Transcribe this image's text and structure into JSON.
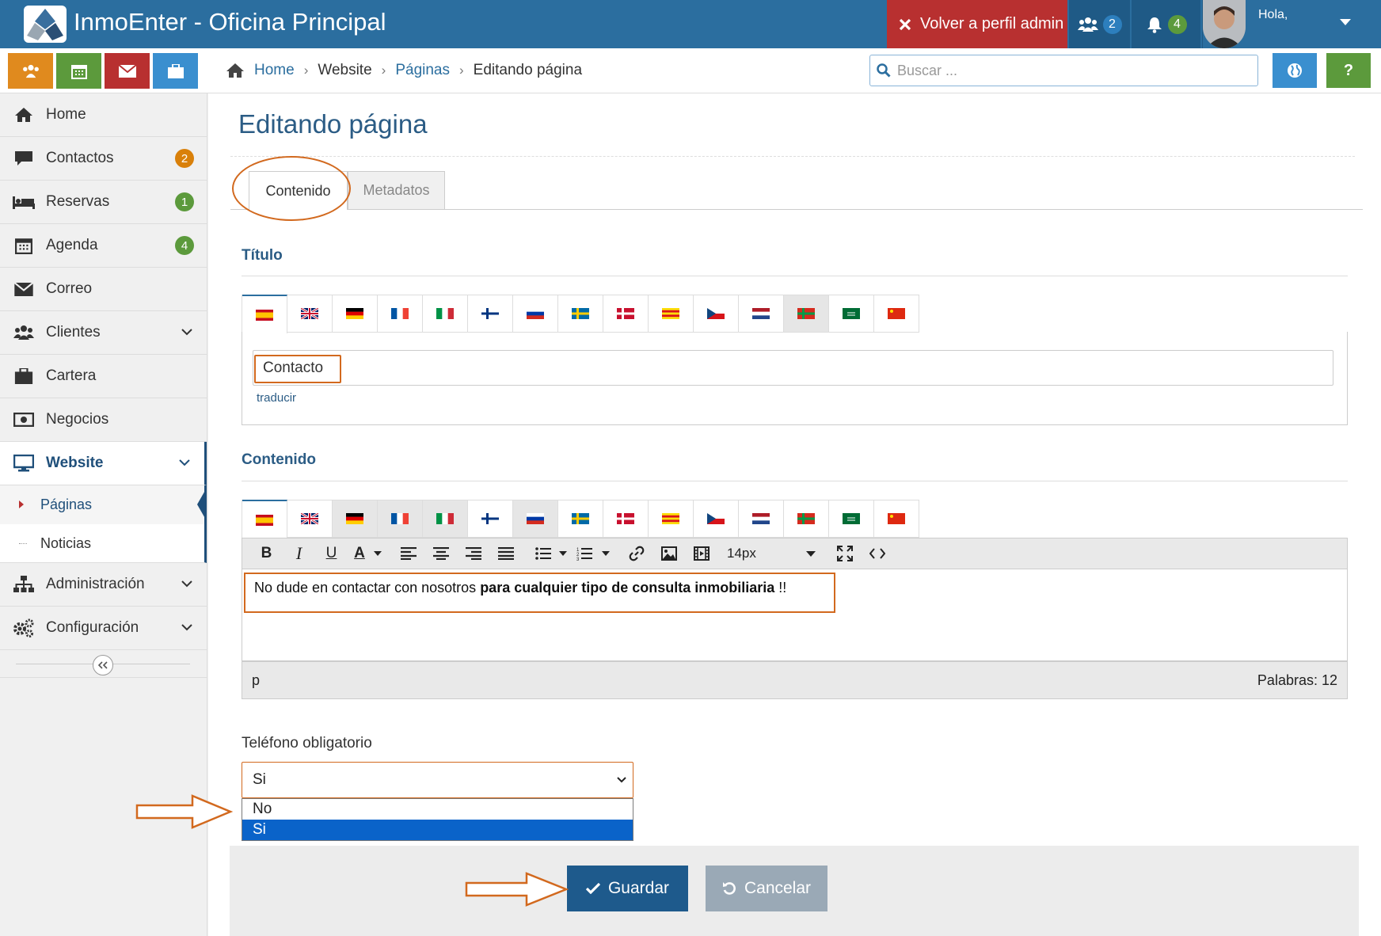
{
  "header": {
    "app_title": "InmoEnter - Oficina Principal",
    "admin_button": "Volver a perfil admin",
    "users_count": "2",
    "notifications_count": "4",
    "greeting": "Hola,"
  },
  "breadcrumb": {
    "home": "Home",
    "website": "Website",
    "pages": "Páginas",
    "current": "Editando página"
  },
  "search": {
    "placeholder": "Buscar ..."
  },
  "help_label": "?",
  "sidebar": {
    "items": [
      {
        "label": "Home"
      },
      {
        "label": "Contactos",
        "badge": "2"
      },
      {
        "label": "Reservas",
        "badge": "1"
      },
      {
        "label": "Agenda",
        "badge": "4"
      },
      {
        "label": "Correo"
      },
      {
        "label": "Clientes"
      },
      {
        "label": "Cartera"
      },
      {
        "label": "Negocios"
      },
      {
        "label": "Website"
      },
      {
        "label": "Administración"
      },
      {
        "label": "Configuración"
      }
    ],
    "subitems": [
      {
        "label": "Páginas"
      },
      {
        "label": "Noticias"
      }
    ]
  },
  "page": {
    "title": "Editando página",
    "tabs": [
      "Contenido",
      "Metadatos"
    ],
    "titulo_label": "Título",
    "titulo_value": "Contacto",
    "translate_link": "traducir",
    "contenido_label": "Contenido",
    "editor_text_normal": "No dude en contactar con nosotros ",
    "editor_text_bold": "para cualquier tipo de consulta inmobiliaria",
    "editor_text_end": " !!",
    "font_size": "14px",
    "status_tag": "p",
    "word_count": "Palabras: 12",
    "phone_label": "Teléfono obligatorio",
    "phone_selected": "Si",
    "phone_options": [
      "No",
      "Si"
    ],
    "save_button": "Guardar",
    "cancel_button": "Cancelar"
  },
  "language_flags": [
    "es",
    "gb",
    "de",
    "fr",
    "it",
    "fi",
    "ru",
    "se",
    "dk",
    "ca",
    "cz",
    "nl",
    "eu",
    "sa",
    "cn"
  ],
  "colors": {
    "header": "#2b6e9f",
    "accent": "#2b5c85",
    "admin_button": "#b83030",
    "annotation": "#d2691e",
    "save_button": "#1e5a8c",
    "cancel_button": "#9aa9b6",
    "badge_orange": "#d9800a",
    "badge_green": "#5c9a3c"
  }
}
